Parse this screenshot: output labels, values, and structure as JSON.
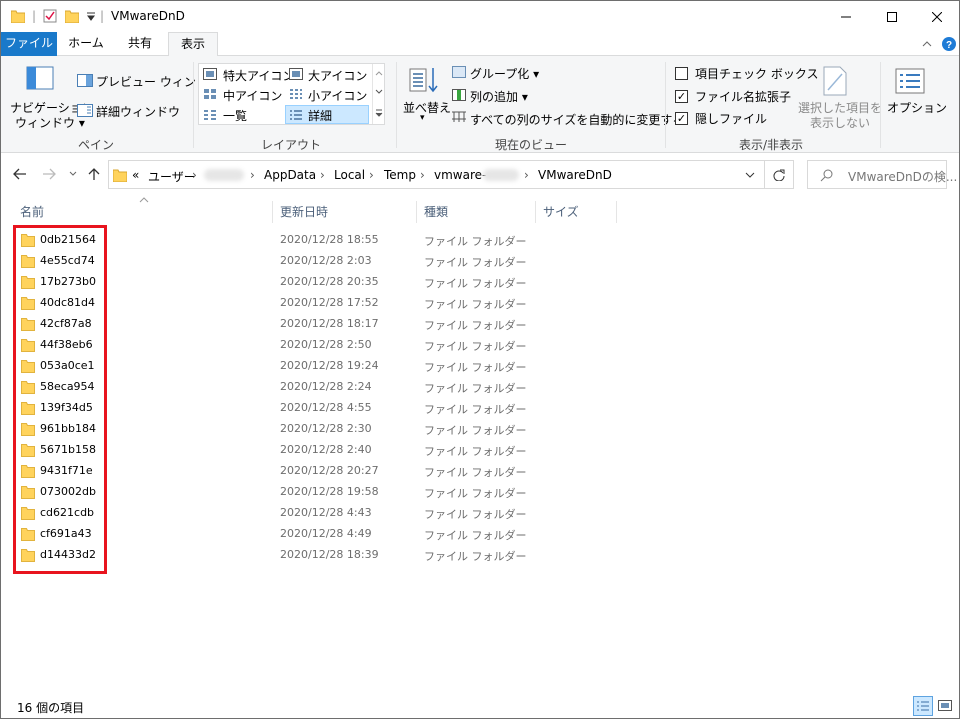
{
  "window": {
    "title": "VMwareDnD"
  },
  "ribbon_tabs": [
    {
      "label": "ファイル"
    },
    {
      "label": "ホーム"
    },
    {
      "label": "共有"
    },
    {
      "label": "表示"
    }
  ],
  "ribbon": {
    "pane_group": {
      "nav_pane_line1": "ナビゲーション",
      "nav_pane_line2": "ウィンドウ",
      "preview_pane": "プレビュー ウィンドウ",
      "details_pane": "詳細ウィンドウ",
      "label": "ペイン"
    },
    "layout_group": {
      "options": [
        {
          "label": "特大アイコン"
        },
        {
          "label": "大アイコン"
        },
        {
          "label": "中アイコン"
        },
        {
          "label": "小アイコン"
        },
        {
          "label": "一覧"
        },
        {
          "label": "詳細"
        }
      ],
      "selected": "詳細",
      "label": "レイアウト"
    },
    "current_view_group": {
      "sort_line1": "並べ替え",
      "group_by": "グループ化",
      "add_columns": "列の追加",
      "autosize": "すべての列のサイズを自動的に変更する",
      "label": "現在のビュー"
    },
    "show_hide_group": {
      "item_checkboxes": {
        "label": "項目チェック ボックス",
        "checked": false
      },
      "file_extensions": {
        "label": "ファイル名拡張子",
        "checked": true
      },
      "hidden_items": {
        "label": "隠しファイル",
        "checked": true
      },
      "hide_selected_line1": "選択した項目を",
      "hide_selected_line2": "表示しない",
      "label": "表示/非表示"
    },
    "options_label": "オプション"
  },
  "address": {
    "breadcrumbs": [
      "ユーザー",
      "AppData",
      "Local",
      "Temp",
      "vmware-",
      "VMwareDnD"
    ],
    "search_placeholder": "VMwareDnDの検..."
  },
  "columns": [
    "名前",
    "更新日時",
    "種類",
    "サイズ"
  ],
  "files": [
    {
      "name": "0db21564",
      "modified": "2020/12/28 18:55",
      "type": "ファイル フォルダー"
    },
    {
      "name": "4e55cd74",
      "modified": "2020/12/28 2:03",
      "type": "ファイル フォルダー"
    },
    {
      "name": "17b273b0",
      "modified": "2020/12/28 20:35",
      "type": "ファイル フォルダー"
    },
    {
      "name": "40dc81d4",
      "modified": "2020/12/28 17:52",
      "type": "ファイル フォルダー"
    },
    {
      "name": "42cf87a8",
      "modified": "2020/12/28 18:17",
      "type": "ファイル フォルダー"
    },
    {
      "name": "44f38eb6",
      "modified": "2020/12/28 2:50",
      "type": "ファイル フォルダー"
    },
    {
      "name": "053a0ce1",
      "modified": "2020/12/28 19:24",
      "type": "ファイル フォルダー"
    },
    {
      "name": "58eca954",
      "modified": "2020/12/28 2:24",
      "type": "ファイル フォルダー"
    },
    {
      "name": "139f34d5",
      "modified": "2020/12/28 4:55",
      "type": "ファイル フォルダー"
    },
    {
      "name": "961bb184",
      "modified": "2020/12/28 2:30",
      "type": "ファイル フォルダー"
    },
    {
      "name": "5671b158",
      "modified": "2020/12/28 2:40",
      "type": "ファイル フォルダー"
    },
    {
      "name": "9431f71e",
      "modified": "2020/12/28 20:27",
      "type": "ファイル フォルダー"
    },
    {
      "name": "073002db",
      "modified": "2020/12/28 19:58",
      "type": "ファイル フォルダー"
    },
    {
      "name": "cd621cdb",
      "modified": "2020/12/28 4:43",
      "type": "ファイル フォルダー"
    },
    {
      "name": "cf691a43",
      "modified": "2020/12/28 4:49",
      "type": "ファイル フォルダー"
    },
    {
      "name": "d14433d2",
      "modified": "2020/12/28 18:39",
      "type": "ファイル フォルダー"
    }
  ],
  "status": {
    "item_count": "16 個の項目"
  },
  "colors": {
    "file_tab": "#1979ca",
    "highlight_box": "#e8141e",
    "folder": "#ffd35c",
    "selected_layout": "#cce8ff"
  }
}
